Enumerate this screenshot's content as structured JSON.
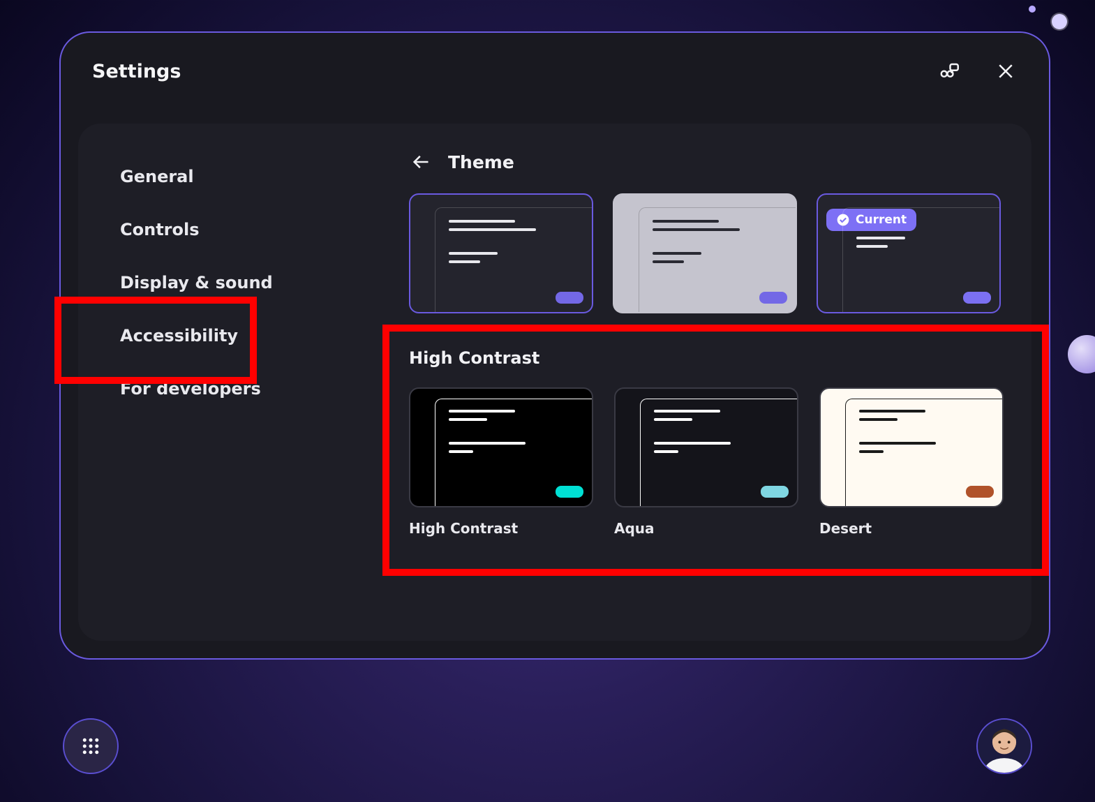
{
  "window": {
    "title": "Settings"
  },
  "sidebar": {
    "items": [
      {
        "label": "General"
      },
      {
        "label": "Controls"
      },
      {
        "label": "Display & sound"
      },
      {
        "label": "Accessibility"
      },
      {
        "label": "For developers"
      }
    ],
    "highlighted_index": 3
  },
  "content": {
    "title": "Theme",
    "current_badge": "Current",
    "themes": [
      {
        "id": "dark",
        "selected": true,
        "current": false
      },
      {
        "id": "light",
        "selected": false,
        "current": false
      },
      {
        "id": "mesh",
        "selected": true,
        "current": true
      }
    ],
    "high_contrast": {
      "title": "High Contrast",
      "items": [
        {
          "id": "high-contrast",
          "label": "High Contrast"
        },
        {
          "id": "aqua",
          "label": "Aqua"
        },
        {
          "id": "desert",
          "label": "Desert"
        }
      ]
    }
  },
  "annotations": {
    "sidebar_box": true,
    "high_contrast_box": true
  }
}
